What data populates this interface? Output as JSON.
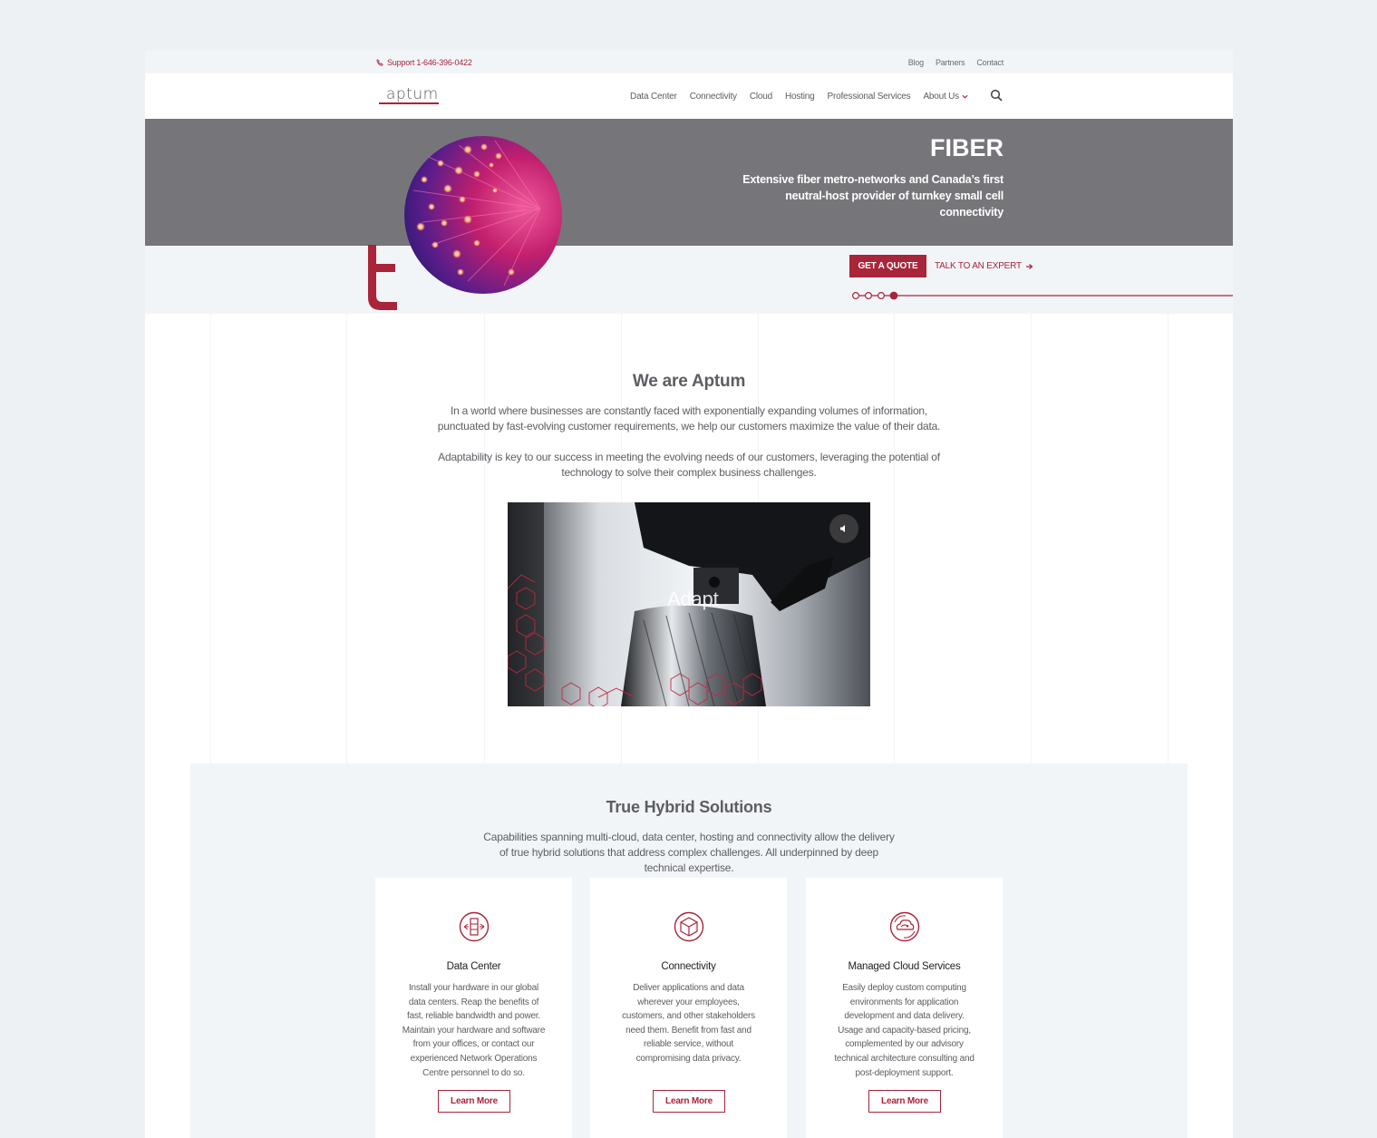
{
  "utility_bar": {
    "support_label": "Support 1-646-396-0422",
    "links": [
      "Blog",
      "Partners",
      "Contact"
    ]
  },
  "nav": {
    "logo_text": "aptum",
    "items": [
      "Data Center",
      "Connectivity",
      "Cloud",
      "Hosting",
      "Professional Services",
      "About Us"
    ]
  },
  "hero": {
    "title": "FIBER",
    "subtitle": "Extensive fiber metro-networks and Canada’s first neutral-host provider of turnkey small cell connectivity",
    "cta_primary": "GET A QUOTE",
    "cta_secondary": "TALK TO AN EXPERT",
    "slides_total": 4,
    "active_slide": 4
  },
  "about": {
    "title": "We are Aptum",
    "paragraph1": "In a world where businesses are constantly faced with exponentially expanding volumes of information, punctuated by fast-evolving customer requirements, we help our customers maximize the value of their data.",
    "paragraph2": "Adaptability is key to our success in meeting the evolving needs of our customers, leveraging the potential of technology to solve their complex business challenges.",
    "video_word": "Adapt"
  },
  "hybrid": {
    "title": "True Hybrid Solutions",
    "subtitle": "Capabilities spanning multi-cloud, data center, hosting and connectivity allow the delivery of true hybrid solutions that address complex challenges. All underpinned by deep technical expertise.",
    "cards": [
      {
        "icon": "server-rack-icon",
        "title": "Data Center",
        "description": "Install your hardware in our global data centers. Reap the benefits of fast, reliable bandwidth and power. Maintain your hardware and software from your offices, or contact our experienced Network Operations Centre personnel to do so.",
        "button": "Learn More"
      },
      {
        "icon": "cube-icon",
        "title": "Connectivity",
        "description": "Deliver applications and data wherever your employees, customers, and other stakeholders need them. Benefit from fast and reliable service, without compromising data privacy.",
        "button": "Learn More"
      },
      {
        "icon": "cloud-sync-icon",
        "title": "Managed Cloud Services",
        "description": "Easily deploy custom computing environments for application development and data delivery. Usage and capacity-based pricing, complemented by our advisory technical architecture consulting and post-deployment support.",
        "button": "Learn More"
      }
    ]
  },
  "colors": {
    "brand": "#a8253a",
    "hero_bg": "#76767a",
    "light_bg": "#f2f5f8",
    "text": "#5d5d63"
  }
}
